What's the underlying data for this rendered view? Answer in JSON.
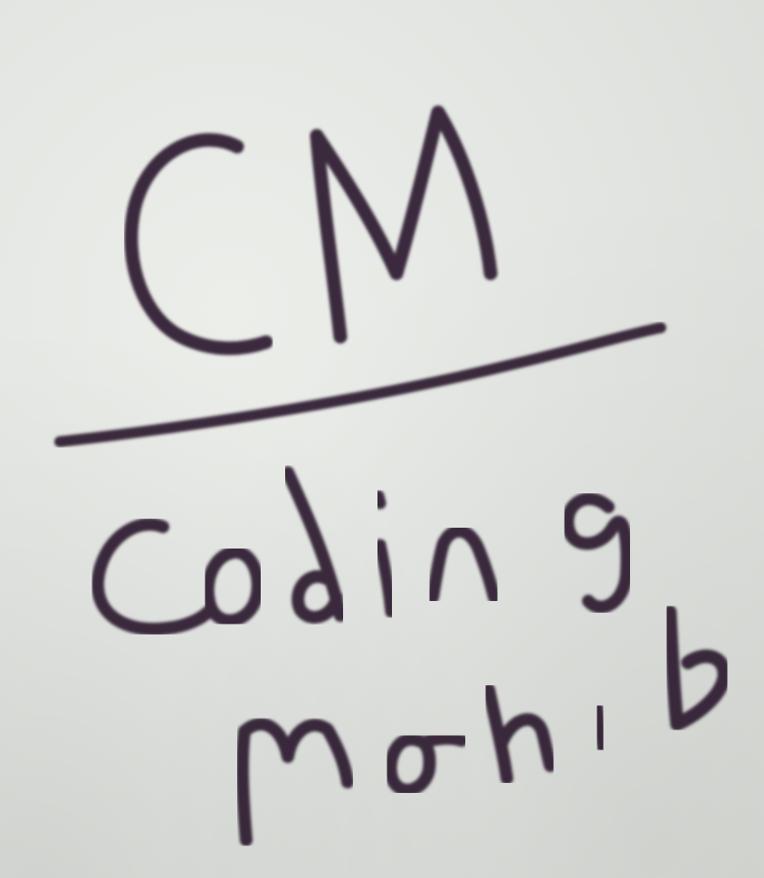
{
  "logo": {
    "monogram": "CM",
    "line1": "Coding",
    "line2": "mohib"
  },
  "colors": {
    "paper": "#e2e5e1",
    "ink": "#3a2a3c"
  }
}
